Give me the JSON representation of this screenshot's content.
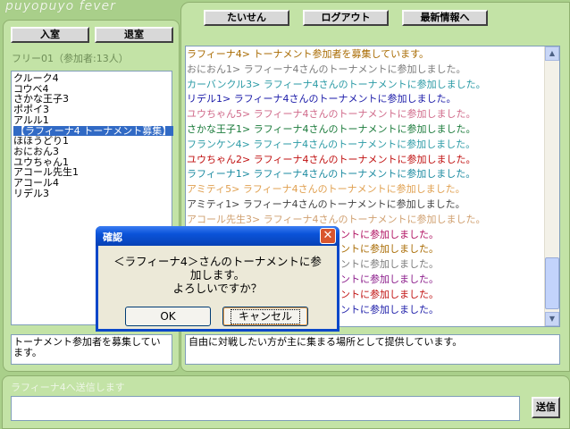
{
  "app": {
    "logo": "puyopuyo fever"
  },
  "buttons": {
    "enter": "入室",
    "leave": "退室",
    "battle": "たいせん",
    "logout": "ログアウト",
    "news": "最新情報へ",
    "send": "送信"
  },
  "room": {
    "label": "フリー01（参加者:13人）"
  },
  "users": [
    "クルーク4",
    "コウベ4",
    "さかな王子3",
    "ポポイ3",
    "アルル1",
    "【ラフィーナ4 トーナメント募集】",
    "ほほうどり1",
    "おにおん3",
    "ユウちゃん1",
    "アコール先生1",
    "アコール4",
    "リデル3"
  ],
  "selected_user_index": 5,
  "chat": [
    {
      "text": "ラフィーナ4> トーナメント参加者を募集しています。",
      "color": "#a86a00"
    },
    {
      "text": "おにおん1> ラフィーナ4さんのトーナメントに参加しました。",
      "color": "#7a7a7a"
    },
    {
      "text": "カーバンクル3> ラフィーナ4さんのトーナメントに参加しました。",
      "color": "#2a9aa5"
    },
    {
      "text": "リデル1> ラフィーナ4さんのトーナメントに参加しました。",
      "color": "#1a1aa8"
    },
    {
      "text": "ユウちゃん5> ラフィーナ4さんのトーナメントに参加しました。",
      "color": "#d06a8a"
    },
    {
      "text": "さかな王子1> ラフィーナ4さんのトーナメントに参加しました。",
      "color": "#1a7a3a"
    },
    {
      "text": "フランケン4> ラフィーナ4さんのトーナメントに参加しました。",
      "color": "#2a9aa5"
    },
    {
      "text": "ユウちゃん2> ラフィーナ4さんのトーナメントに参加しました。",
      "color": "#c01010"
    },
    {
      "text": "ラフィーナ1> ラフィーナ4さんのトーナメントに参加しました。",
      "color": "#1a8aa0"
    },
    {
      "text": "アミティ5> ラフィーナ4さんのトーナメントに参加しました。",
      "color": "#e0a050"
    },
    {
      "text": "アミティ1> ラフィーナ4さんのトーナメントに参加しました。",
      "color": "#404040"
    },
    {
      "text": "アコール先生3> ラフィーナ4さんのトーナメントに参加しました。",
      "color": "#d0a070"
    },
    {
      "text": "ントに参加しました。",
      "color": "#b01060"
    },
    {
      "text": "ントに参加しました。",
      "color": "#a86a00"
    },
    {
      "text": "ントに参加しました。",
      "color": "#7a7a7a"
    },
    {
      "text": "ントに参加しました。",
      "color": "#8a1a8a"
    },
    {
      "text": "ントに参加しました。",
      "color": "#c01010"
    },
    {
      "text": "ントに参加しました。",
      "color": "#1a1aa8"
    }
  ],
  "room_desc_left": "トーナメント参加者を募集しています。",
  "room_desc_right": "自由に対戦したい方が主に集まる場所として提供しています。",
  "send_label": "ラフィーナ4へ送信します",
  "send_value": "",
  "dialog": {
    "title": "確認",
    "line1": "＜ラフィーナ4＞さんのトーナメントに参",
    "line2": "加します。",
    "line3": "よろしいですか？",
    "ok": "OK",
    "cancel": "キャンセル"
  }
}
